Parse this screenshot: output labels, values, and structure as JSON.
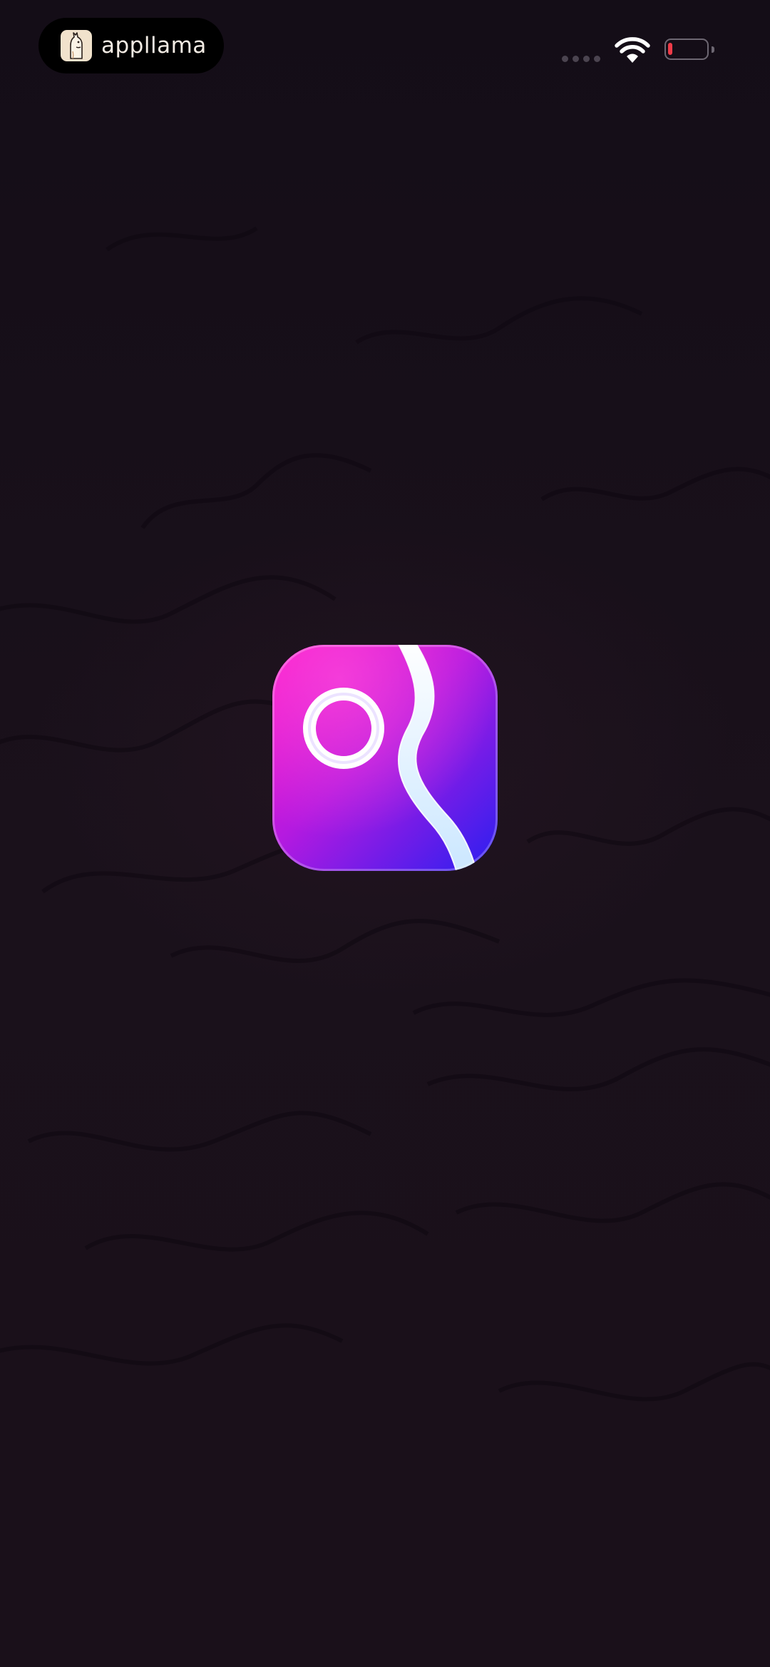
{
  "status_bar": {
    "pill_label": "appllama",
    "pill_logo_icon": "llama-logo-icon",
    "signal_icon": "cellular-signal-icon",
    "wifi_icon": "wifi-icon",
    "battery_icon": "battery-low-icon",
    "battery_level_color": "#ee3b48"
  },
  "splash": {
    "app_icon": "map-pin-route-app-icon",
    "icon_gradient_colors": [
      "#ff14c8",
      "#b41ae0",
      "#2a1ff0"
    ]
  }
}
